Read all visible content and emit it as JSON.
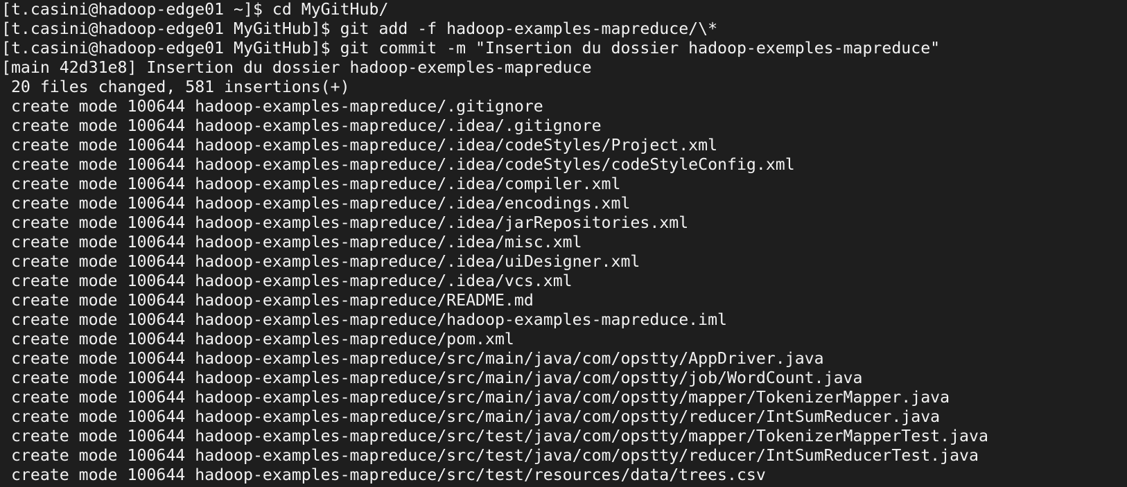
{
  "terminal": {
    "lines": [
      "[t.casini@hadoop-edge01 ~]$ cd MyGitHub/",
      "[t.casini@hadoop-edge01 MyGitHub]$ git add -f hadoop-examples-mapreduce/\\*",
      "[t.casini@hadoop-edge01 MyGitHub]$ git commit -m \"Insertion du dossier hadoop-exemples-mapreduce\"",
      "[main 42d31e8] Insertion du dossier hadoop-exemples-mapreduce",
      " 20 files changed, 581 insertions(+)",
      " create mode 100644 hadoop-examples-mapreduce/.gitignore",
      " create mode 100644 hadoop-examples-mapreduce/.idea/.gitignore",
      " create mode 100644 hadoop-examples-mapreduce/.idea/codeStyles/Project.xml",
      " create mode 100644 hadoop-examples-mapreduce/.idea/codeStyles/codeStyleConfig.xml",
      " create mode 100644 hadoop-examples-mapreduce/.idea/compiler.xml",
      " create mode 100644 hadoop-examples-mapreduce/.idea/encodings.xml",
      " create mode 100644 hadoop-examples-mapreduce/.idea/jarRepositories.xml",
      " create mode 100644 hadoop-examples-mapreduce/.idea/misc.xml",
      " create mode 100644 hadoop-examples-mapreduce/.idea/uiDesigner.xml",
      " create mode 100644 hadoop-examples-mapreduce/.idea/vcs.xml",
      " create mode 100644 hadoop-examples-mapreduce/README.md",
      " create mode 100644 hadoop-examples-mapreduce/hadoop-examples-mapreduce.iml",
      " create mode 100644 hadoop-examples-mapreduce/pom.xml",
      " create mode 100644 hadoop-examples-mapreduce/src/main/java/com/opstty/AppDriver.java",
      " create mode 100644 hadoop-examples-mapreduce/src/main/java/com/opstty/job/WordCount.java",
      " create mode 100644 hadoop-examples-mapreduce/src/main/java/com/opstty/mapper/TokenizerMapper.java",
      " create mode 100644 hadoop-examples-mapreduce/src/main/java/com/opstty/reducer/IntSumReducer.java",
      " create mode 100644 hadoop-examples-mapreduce/src/test/java/com/opstty/mapper/TokenizerMapperTest.java",
      " create mode 100644 hadoop-examples-mapreduce/src/test/java/com/opstty/reducer/IntSumReducerTest.java",
      " create mode 100644 hadoop-examples-mapreduce/src/test/resources/data/trees.csv"
    ],
    "colors": {
      "background": "#1e1e1e",
      "foreground": "#f2f2f2"
    }
  }
}
